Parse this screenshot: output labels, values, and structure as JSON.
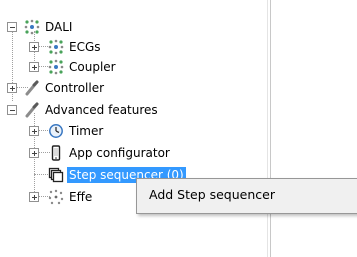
{
  "tree": {
    "dali": {
      "label": "DALI",
      "icon": "network-nodes-icon",
      "expanded": true
    },
    "ecgs": {
      "label": "ECGs",
      "icon": "network-nodes-icon",
      "expanded": false
    },
    "coupler": {
      "label": "Coupler",
      "icon": "network-nodes-icon",
      "expanded": false
    },
    "controller": {
      "label": "Controller",
      "icon": "wand-icon",
      "expanded": false
    },
    "advanced": {
      "label": "Advanced features",
      "icon": "wand-icon",
      "expanded": true
    },
    "timer": {
      "label": "Timer",
      "icon": "clock-icon",
      "expanded": false
    },
    "appconfig": {
      "label": "App configurator",
      "icon": "phone-icon",
      "expanded": false
    },
    "stepseq": {
      "label": "Step sequencer (0)",
      "icon": "stack-icon",
      "selected": true
    },
    "effects": {
      "label": "Effe",
      "icon": "sparkle-icon",
      "expanded": false
    }
  },
  "context_menu": {
    "items": [
      {
        "label": "Add Step sequencer"
      }
    ]
  },
  "colors": {
    "selection": "#3399ff",
    "menu_bg": "#f0f0f0"
  }
}
